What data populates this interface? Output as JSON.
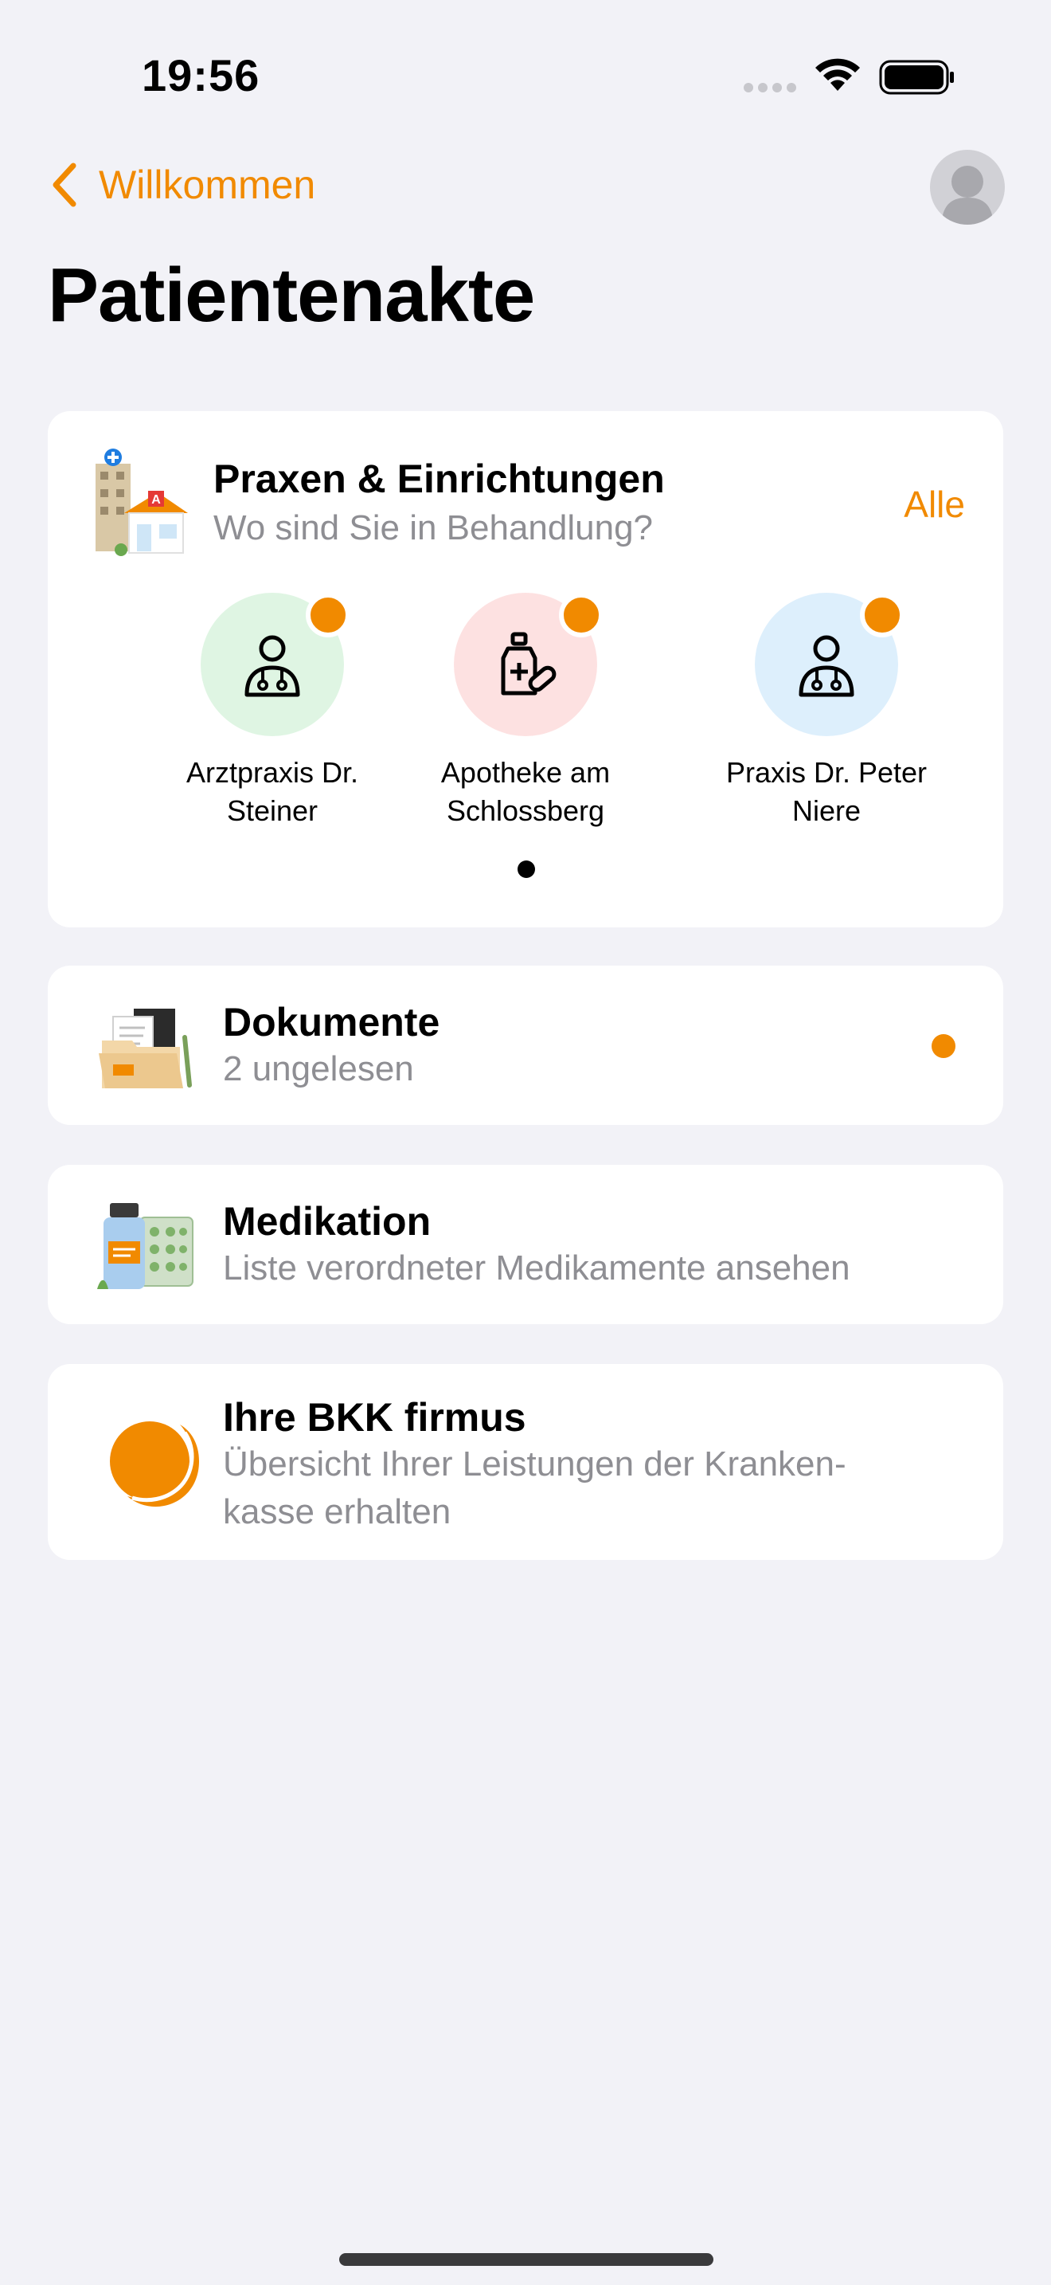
{
  "status_bar": {
    "time": "19:56"
  },
  "nav": {
    "back_label": "Willkommen"
  },
  "page": {
    "title": "Patientenakte"
  },
  "praxen": {
    "title": "Praxen & Einrichtungen",
    "subtitle": "Wo sind Sie in Behandlung?",
    "all_label": "Alle",
    "facilities": [
      {
        "line1": "Arztpraxis Dr.",
        "line2": "Steiner",
        "icon": "doctor-icon",
        "bg": "#dff5e3"
      },
      {
        "line1": "Apotheke am",
        "line2": "Schlossberg",
        "icon": "pharmacy-icon",
        "bg": "#fde1e1"
      },
      {
        "line1": "Praxis Dr. Peter",
        "line2": "Niere",
        "icon": "doctor-icon",
        "bg": "#ddeffc"
      }
    ]
  },
  "rows": {
    "dokumente": {
      "title": "Dokumente",
      "subtitle": "2 ungelesen"
    },
    "medikation": {
      "title": "Medikation",
      "subtitle": "Liste verordneter Medikamente ansehen"
    },
    "bkk": {
      "title": "Ihre BKK firmus",
      "subtitle_line1": "Übersicht Ihrer Leistungen der Kranken-",
      "subtitle_line2": "kasse erhalten"
    }
  },
  "colors": {
    "accent": "#f18a00",
    "background": "#f2f2f7",
    "secondary_text": "#8e8e93"
  }
}
